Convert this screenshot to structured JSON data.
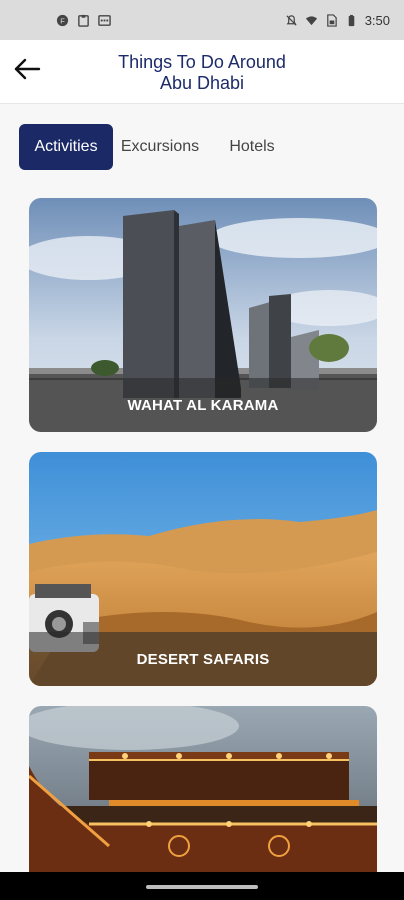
{
  "status_bar": {
    "time": "3:50",
    "left_icons": [
      "app-f-icon",
      "clipboard-icon",
      "calendar-icon"
    ],
    "right_icons": [
      "notifications-off-icon",
      "wifi-icon",
      "sim-icon",
      "battery-icon"
    ]
  },
  "header": {
    "title_line1": "Things To Do Around",
    "title_line2": "Abu Dhabi",
    "back_icon": "arrow-left-icon"
  },
  "tabs": [
    {
      "label": "Activities",
      "selected": true
    },
    {
      "label": "Excursions",
      "selected": false
    },
    {
      "label": "Hotels",
      "selected": false
    }
  ],
  "cards": [
    {
      "label": "WAHAT AL KARAMA"
    },
    {
      "label": "DESERT SAFARIS"
    },
    {
      "label": ""
    }
  ],
  "colors": {
    "primary": "#1b2a66",
    "title": "#1d2b6b",
    "overlay": "rgba(40,40,40,0.55)"
  }
}
